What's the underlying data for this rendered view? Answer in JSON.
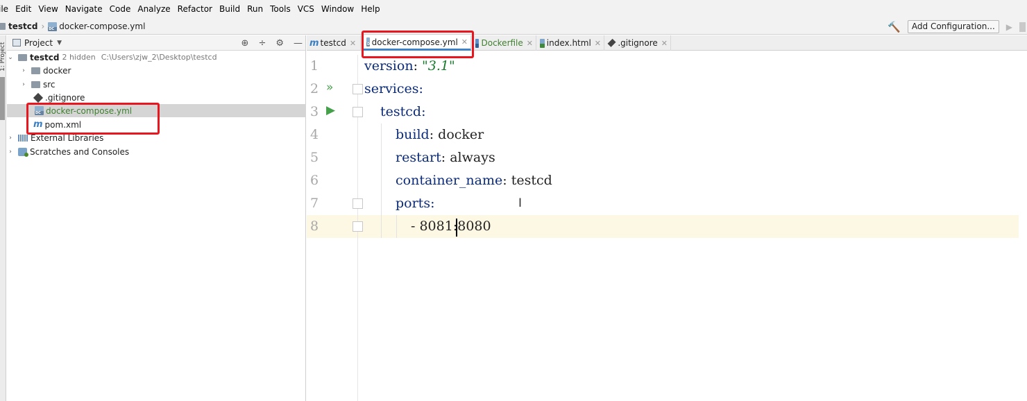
{
  "menu": [
    "ile",
    "Edit",
    "View",
    "Navigate",
    "Code",
    "Analyze",
    "Refactor",
    "Build",
    "Run",
    "Tools",
    "VCS",
    "Window",
    "Help"
  ],
  "nav": {
    "project": "testcd",
    "file": "docker-compose.yml",
    "add_config": "Add Configuration..."
  },
  "project_panel": {
    "title": "Project",
    "strip_label": "1: Project",
    "tree": {
      "root": "testcd",
      "root_hint": "2 hidden",
      "root_path": "C:\\Users\\zjw_2\\Desktop\\testcd",
      "items": [
        "docker",
        "src",
        ".gitignore",
        "docker-compose.yml",
        "pom.xml"
      ],
      "external": "External Libraries",
      "scratches": "Scratches and Consoles"
    }
  },
  "tabs": [
    "testcd",
    "docker-compose.yml",
    "Dockerfile",
    "index.html",
    ".gitignore"
  ],
  "editor": {
    "line_numbers": [
      "1",
      "2",
      "3",
      "4",
      "5",
      "6",
      "7",
      "8"
    ],
    "code": {
      "l1_key": "version",
      "l1_val": "\"3.1\"",
      "l2_key": "services",
      "l3_key": "testcd",
      "l4_key": "build",
      "l4_val": "docker",
      "l5_key": "restart",
      "l5_val": "always",
      "l6_key": "container_name",
      "l6_val": "testcd",
      "l7_key": "ports",
      "l8_a": "- 8081",
      "l8_b": ":8080"
    }
  },
  "colors": {
    "highlight_box": "#e8161e",
    "yaml_key": "#0b2a78",
    "yaml_string": "#157a2a",
    "current_line": "#fdf8e4"
  }
}
